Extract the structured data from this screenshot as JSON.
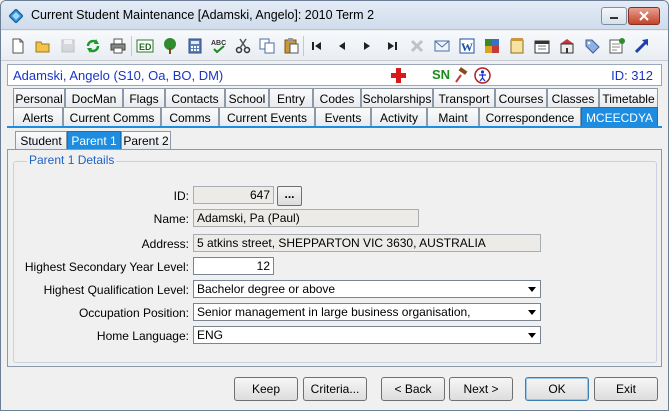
{
  "window": {
    "title": "Current Student Maintenance  [Adamski, Angelo]:  2010 Term 2"
  },
  "student": {
    "name": "Adamski, Angelo (S10, Oa, BO, DM)",
    "flag_sn": "SN",
    "id_text": "ID: 312"
  },
  "tabs_row1": [
    "Personal",
    "DocMan",
    "Flags",
    "Contacts",
    "School",
    "Entry",
    "Codes",
    "Scholarships",
    "Transport",
    "Courses",
    "Classes",
    "Timetable"
  ],
  "tabs_row2": [
    "Alerts",
    "Current Comms",
    "Comms",
    "Current Events",
    "Events",
    "Activity",
    "Maint",
    "Correspondence",
    "MCEECDYA"
  ],
  "subtabs": [
    "Student",
    "Parent 1",
    "Parent 2"
  ],
  "form": {
    "group_title": "Parent 1 Details",
    "id_label": "ID:",
    "id_value": "647",
    "lookup_button": "...",
    "name_label": "Name:",
    "name_value": "Adamski, Pa (Paul)",
    "address_label": "Address:",
    "address_value": "5 atkins street, SHEPPARTON VIC 3630, AUSTRALIA",
    "secondary_label": "Highest Secondary Year Level:",
    "secondary_value": "12",
    "qualification_label": "Highest Qualification Level:",
    "qualification_value": "Bachelor degree or above",
    "occupation_label": "Occupation Position:",
    "occupation_value": "Senior management in large business organisation,",
    "language_label": "Home Language:",
    "language_value": "ENG"
  },
  "buttons": {
    "keep": "Keep",
    "criteria": "Criteria...",
    "back": "< Back",
    "next": "Next >",
    "ok": "OK",
    "exit": "Exit"
  },
  "colors": {
    "accent_tab": "#1e8de0",
    "student_text": "#1a34c6",
    "group_title": "#1f62c4"
  }
}
